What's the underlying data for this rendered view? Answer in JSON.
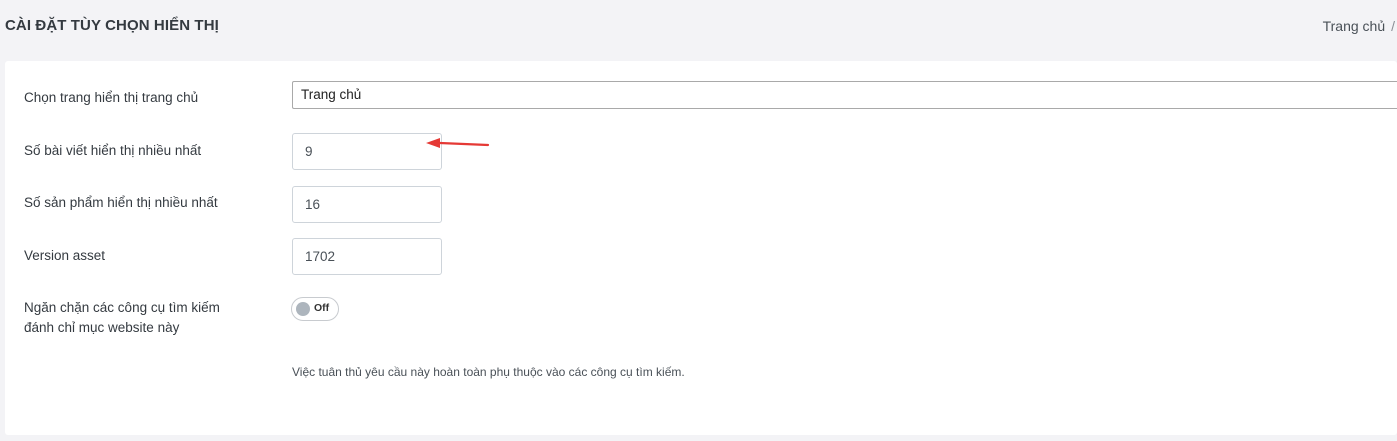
{
  "header": {
    "title": "CÀI ĐẶT TÙY CHỌN HIỂN THỊ",
    "breadcrumb": {
      "home": "Trang chủ",
      "separator": "/"
    }
  },
  "form": {
    "home_page": {
      "label": "Chọn trang hiển thị trang chủ",
      "value": "Trang chủ"
    },
    "max_posts": {
      "label": "Số bài viết hiển thị nhiều nhất",
      "value": "9"
    },
    "max_products": {
      "label": "Số sản phẩm hiển thị nhiều nhất",
      "value": "16"
    },
    "version_asset": {
      "label": "Version asset",
      "value": "1702"
    },
    "block_indexing": {
      "label_line1": "Ngăn chặn các công cụ tìm kiếm",
      "label_line2": "đánh chỉ mục website này",
      "toggle_text": "Off",
      "help_text": "Việc tuân thủ yêu cầu này hoàn toàn phụ thuộc vào các công cụ tìm kiếm."
    }
  },
  "annotation": {
    "arrow_color": "#e53935"
  }
}
